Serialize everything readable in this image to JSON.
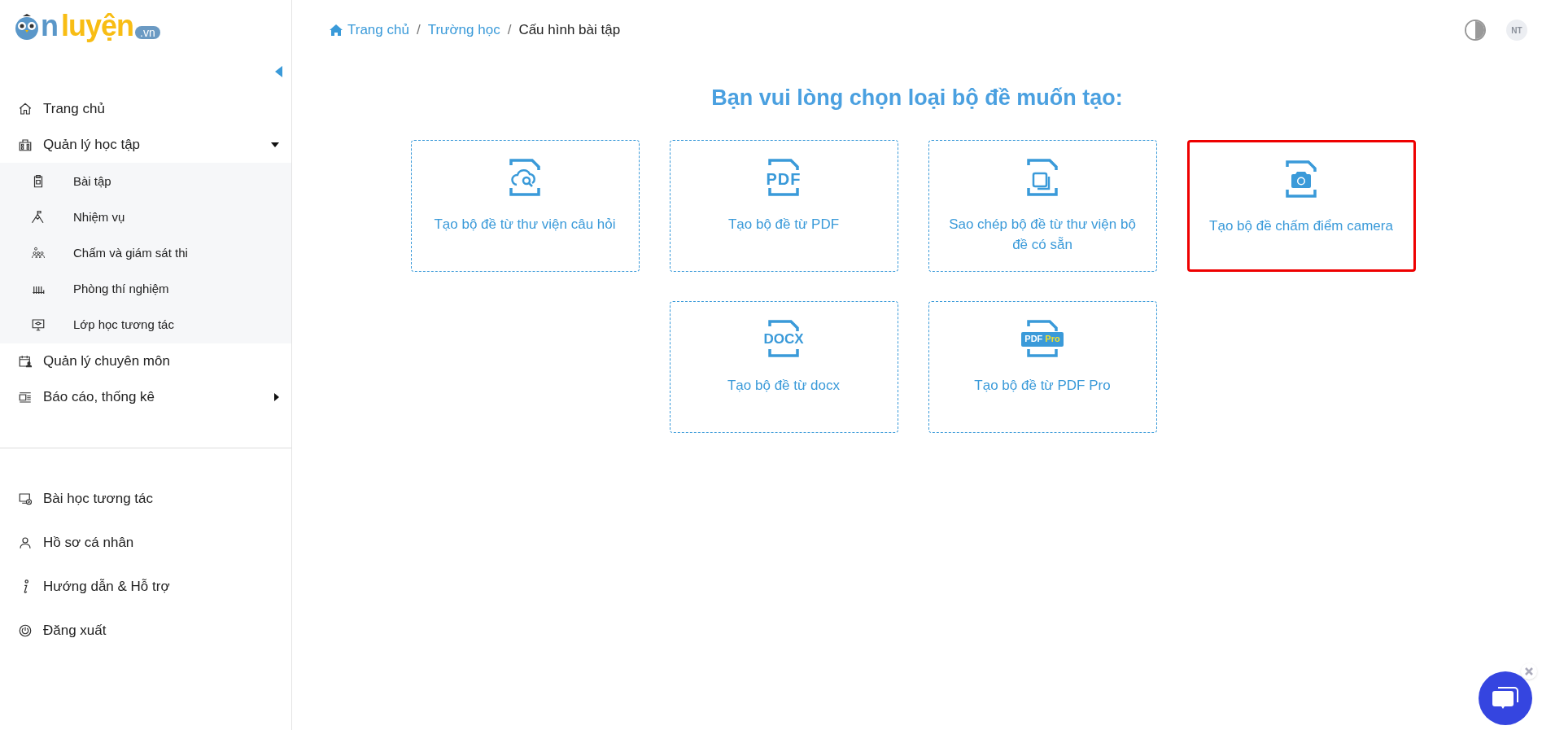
{
  "logo": {
    "parts": [
      "n",
      "luyện",
      ".vn"
    ]
  },
  "sidebar": {
    "items": [
      {
        "kind": "home",
        "label": "Trang chủ"
      },
      {
        "kind": "school",
        "label": "Quản lý học tập",
        "expanded": true,
        "children": [
          {
            "kind": "clipboard",
            "label": "Bài tập"
          },
          {
            "kind": "mountain",
            "label": "Nhiệm vụ"
          },
          {
            "kind": "people",
            "label": "Chấm và giám sát thi"
          },
          {
            "kind": "lab",
            "label": "Phòng thí nghiệm"
          },
          {
            "kind": "monitor",
            "label": "Lớp học tương tác"
          }
        ]
      },
      {
        "kind": "calendar",
        "label": "Quản lý chuyên môn"
      },
      {
        "kind": "report",
        "label": "Báo cáo, thống kê",
        "expanded": false
      }
    ],
    "bottom_items": [
      {
        "kind": "lesson",
        "label": "Bài học tương tác"
      },
      {
        "kind": "user",
        "label": "Hồ sơ cá nhân"
      },
      {
        "kind": "info",
        "label": "Hướng dẫn & Hỗ trợ"
      },
      {
        "kind": "power",
        "label": "Đăng xuất"
      }
    ]
  },
  "breadcrumb": [
    {
      "label": "Trang chủ",
      "kind": "link"
    },
    {
      "separator": "/",
      "label": "Trường học",
      "kind": "link"
    },
    {
      "separator": "/",
      "label": "Cấu hình bài tập",
      "kind": "current"
    }
  ],
  "avatar": "NT",
  "heading": "Bạn vui lòng chọn loại bộ đề muốn tạo:",
  "cards": [
    {
      "kind": "cloud-search",
      "label": "Tạo bộ đề từ thư viện câu hỏi",
      "selected": false
    },
    {
      "kind": "pdf",
      "icon_texts": [
        "PDF"
      ],
      "label": "Tạo bộ đề từ PDF",
      "selected": false
    },
    {
      "kind": "copy",
      "label": "Sao chép bộ đề từ thư viện bộ đề có sẵn",
      "selected": false
    },
    {
      "kind": "camera",
      "label": "Tạo bộ đề chấm điểm camera",
      "selected": true
    },
    {
      "kind": "docx",
      "icon_texts": [
        "DOCX"
      ],
      "label": "Tạo bộ đề từ docx",
      "selected": false
    },
    {
      "kind": "pdf-pro",
      "icon_texts": [
        "PDF",
        "Pro"
      ],
      "label": "Tạo bộ đề từ PDF Pro",
      "selected": false
    }
  ]
}
